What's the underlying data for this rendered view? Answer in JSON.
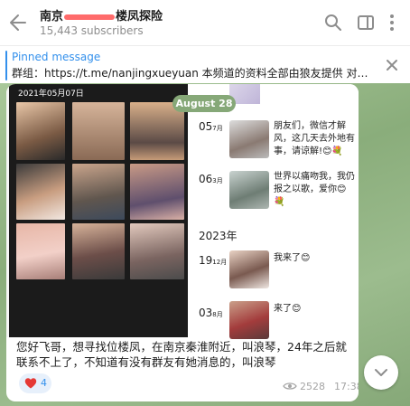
{
  "header": {
    "title_start": "南京",
    "title_end": "楼凤探险",
    "subscribers": "15,443 subscribers"
  },
  "pinned": {
    "label": "Pinned message",
    "text": "群组：https://t.me/nanjingxueyuan 本频道的资料全部由狼友提供 对于优..."
  },
  "post": {
    "photo_date": "2021年05月07日",
    "date_pill": "August 28",
    "entries": [
      {
        "day": "05",
        "month": "7月",
        "text": "朋友们，微信才解风，这几天去外地有事，请谅解!😊💐"
      },
      {
        "day": "06",
        "month": "3月",
        "text": "世界以痛吻我，我仍报之以歌，爱你😊💐"
      },
      {
        "day": "19",
        "month": "12月",
        "text": "我来了😊"
      },
      {
        "day": "03",
        "month": "8月",
        "text": "来了😊"
      }
    ],
    "year": "2023年",
    "caption": "您好飞哥，想寻找位楼凤，在南京秦淮附近，叫浪琴，24年之后就联系不上了，不知道有没有群友有她消息的，叫浪琴",
    "reaction_count": "4",
    "views": "2528",
    "time": "17:38"
  },
  "colors": {
    "accent": "#3390ec",
    "chat_bg": "#8fb07e",
    "reaction_heart": "#e53935"
  },
  "icons": [
    "back-arrow-icon",
    "search-icon",
    "sidebar-toggle-icon",
    "more-vert-icon",
    "close-icon",
    "heart-icon",
    "eye-icon",
    "chevron-down-icon"
  ]
}
